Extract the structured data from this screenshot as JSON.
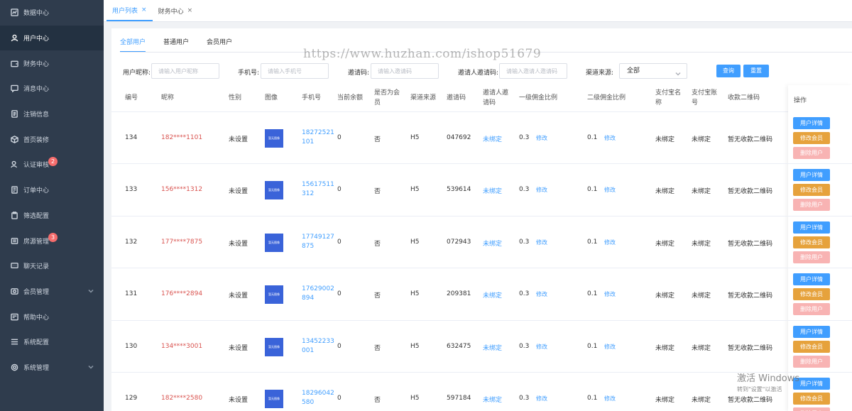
{
  "sidebar": {
    "items": [
      {
        "label": "数据中心",
        "icon": "chart-icon",
        "active": false,
        "badge": "",
        "arrow": false
      },
      {
        "label": "用户中心",
        "icon": "user-icon",
        "active": true,
        "badge": "",
        "arrow": false
      },
      {
        "label": "财务中心",
        "icon": "wallet-icon",
        "active": false,
        "badge": "",
        "arrow": false
      },
      {
        "label": "消息中心",
        "icon": "message-icon",
        "active": false,
        "badge": "",
        "arrow": false
      },
      {
        "label": "注销信息",
        "icon": "document-icon",
        "active": false,
        "badge": "",
        "arrow": false
      },
      {
        "label": "首页装修",
        "icon": "cube-icon",
        "active": false,
        "badge": "",
        "arrow": false
      },
      {
        "label": "认证审核",
        "icon": "user-check-icon",
        "active": false,
        "badge": "2",
        "arrow": false
      },
      {
        "label": "订单中心",
        "icon": "order-icon",
        "active": false,
        "badge": "",
        "arrow": false
      },
      {
        "label": "筛选配置",
        "icon": "clipboard-icon",
        "active": false,
        "badge": "",
        "arrow": false
      },
      {
        "label": "房源管理",
        "icon": "house-icon",
        "active": false,
        "badge": "3",
        "arrow": false
      },
      {
        "label": "聊天记录",
        "icon": "chat-icon",
        "active": false,
        "badge": "",
        "arrow": false
      },
      {
        "label": "会员管理",
        "icon": "member-icon",
        "active": false,
        "badge": "",
        "arrow": true
      },
      {
        "label": "帮助中心",
        "icon": "help-icon",
        "active": false,
        "badge": "",
        "arrow": false
      },
      {
        "label": "系统配置",
        "icon": "list-icon",
        "active": false,
        "badge": "",
        "arrow": false
      },
      {
        "label": "系统管理",
        "icon": "gear-icon",
        "active": false,
        "badge": "",
        "arrow": true
      }
    ]
  },
  "tabs": [
    {
      "label": "用户列表",
      "close": "×",
      "active": true
    },
    {
      "label": "财务中心",
      "close": "×",
      "active": false
    }
  ],
  "subtabs": [
    {
      "label": "全部用户",
      "active": true
    },
    {
      "label": "普通用户",
      "active": false
    },
    {
      "label": "会员用户",
      "active": false
    }
  ],
  "watermark": "https://www.huzhan.com/ishop51679",
  "filters": {
    "nickname_label": "用户昵称:",
    "nickname_placeholder": "请输入用户昵称",
    "phone_label": "手机号:",
    "phone_placeholder": "请输入手机号",
    "invite_label": "邀请码:",
    "invite_placeholder": "请输入邀请码",
    "inviter_label": "邀请人邀请码:",
    "inviter_placeholder": "请输入邀请人邀请码",
    "channel_label": "渠道来源:",
    "channel_value": "全部",
    "query_label": "查询",
    "reset_label": "重置"
  },
  "table": {
    "headers": {
      "id": "编号",
      "nick": "昵称",
      "gender": "性别",
      "avatar": "图像",
      "phone": "手机号",
      "balance": "当前余额",
      "vip": "是否为会员",
      "channel": "渠道来源",
      "code": "邀请码",
      "inviter": "邀请人邀请码",
      "rate1": "一级佣金比例",
      "rate2": "二级佣金比例",
      "alipay_name": "支付宝名称",
      "alipay_account": "支付宝账号",
      "qr": "收款二维码",
      "ops": "操作"
    },
    "rows": [
      {
        "id": "134",
        "nick": "182****1101",
        "gender": "未设置",
        "avatar": "暂无图像",
        "phone": "18272521101",
        "balance": "0",
        "vip": "否",
        "channel": "H5",
        "code": "047692",
        "inviter": "未绑定",
        "rate1": "0.3",
        "rate2": "0.1",
        "alipay_name": "未绑定",
        "alipay_account": "未绑定",
        "qr": "暂无收款二维码"
      },
      {
        "id": "133",
        "nick": "156****1312",
        "gender": "未设置",
        "avatar": "暂无图像",
        "phone": "15617511312",
        "balance": "0",
        "vip": "否",
        "channel": "H5",
        "code": "539614",
        "inviter": "未绑定",
        "rate1": "0.3",
        "rate2": "0.1",
        "alipay_name": "未绑定",
        "alipay_account": "未绑定",
        "qr": "暂无收款二维码"
      },
      {
        "id": "132",
        "nick": "177****7875",
        "gender": "未设置",
        "avatar": "暂无图像",
        "phone": "17749127875",
        "balance": "0",
        "vip": "否",
        "channel": "H5",
        "code": "072943",
        "inviter": "未绑定",
        "rate1": "0.3",
        "rate2": "0.1",
        "alipay_name": "未绑定",
        "alipay_account": "未绑定",
        "qr": "暂无收款二维码"
      },
      {
        "id": "131",
        "nick": "176****2894",
        "gender": "未设置",
        "avatar": "暂无图像",
        "phone": "17629002894",
        "balance": "0",
        "vip": "否",
        "channel": "H5",
        "code": "209381",
        "inviter": "未绑定",
        "rate1": "0.3",
        "rate2": "0.1",
        "alipay_name": "未绑定",
        "alipay_account": "未绑定",
        "qr": "暂无收款二维码"
      },
      {
        "id": "130",
        "nick": "134****3001",
        "gender": "未设置",
        "avatar": "暂无图像",
        "phone": "13452233001",
        "balance": "0",
        "vip": "否",
        "channel": "H5",
        "code": "632475",
        "inviter": "未绑定",
        "rate1": "0.3",
        "rate2": "0.1",
        "alipay_name": "未绑定",
        "alipay_account": "未绑定",
        "qr": "暂无收款二维码"
      },
      {
        "id": "129",
        "nick": "182****2580",
        "gender": "未设置",
        "avatar": "暂无图像",
        "phone": "18296042580",
        "balance": "0",
        "vip": "否",
        "channel": "H5",
        "code": "597184",
        "inviter": "未绑定",
        "rate1": "0.3",
        "rate2": "0.1",
        "alipay_name": "未绑定",
        "alipay_account": "未绑定",
        "qr": "暂无收款二维码"
      }
    ],
    "edit_label": "修改",
    "op_detail": "用户详情",
    "op_vip": "修改会员",
    "op_delete": "删除用户"
  },
  "windows_activation": {
    "line1": "激活 Windows",
    "line2": "转到\"设置\"以激活"
  },
  "colors": {
    "accent": "#409eff",
    "warning": "#e6a23c",
    "danger_light": "#f8b3b3",
    "nick_red": "#d9534f",
    "sidebar_bg": "#2f3c4d"
  }
}
